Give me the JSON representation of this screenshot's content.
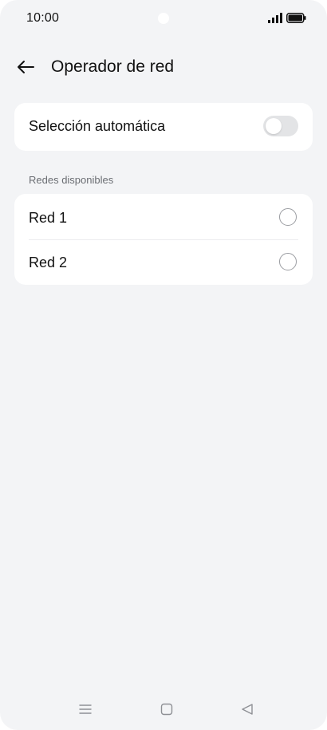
{
  "status_bar": {
    "time": "10:00",
    "icons": [
      "camera-cutout",
      "signal-icon",
      "battery-icon"
    ]
  },
  "header": {
    "back_icon": "arrow-left-icon",
    "title": "Operador de red"
  },
  "auto_selection": {
    "label": "Selección automática",
    "enabled": false
  },
  "networks": {
    "section_label": "Redes disponibles",
    "items": [
      {
        "label": "Red 1",
        "selected": false
      },
      {
        "label": "Red 2",
        "selected": false
      }
    ]
  },
  "nav_bar": {
    "icons": [
      "menu-icon",
      "home-icon",
      "back-icon"
    ]
  },
  "colors": {
    "background": "#f3f4f6",
    "card": "#ffffff",
    "text_primary": "#111111",
    "text_secondary": "#6b6e73",
    "toggle_off": "#e3e4e6",
    "radio_border": "#9a9ca1"
  }
}
